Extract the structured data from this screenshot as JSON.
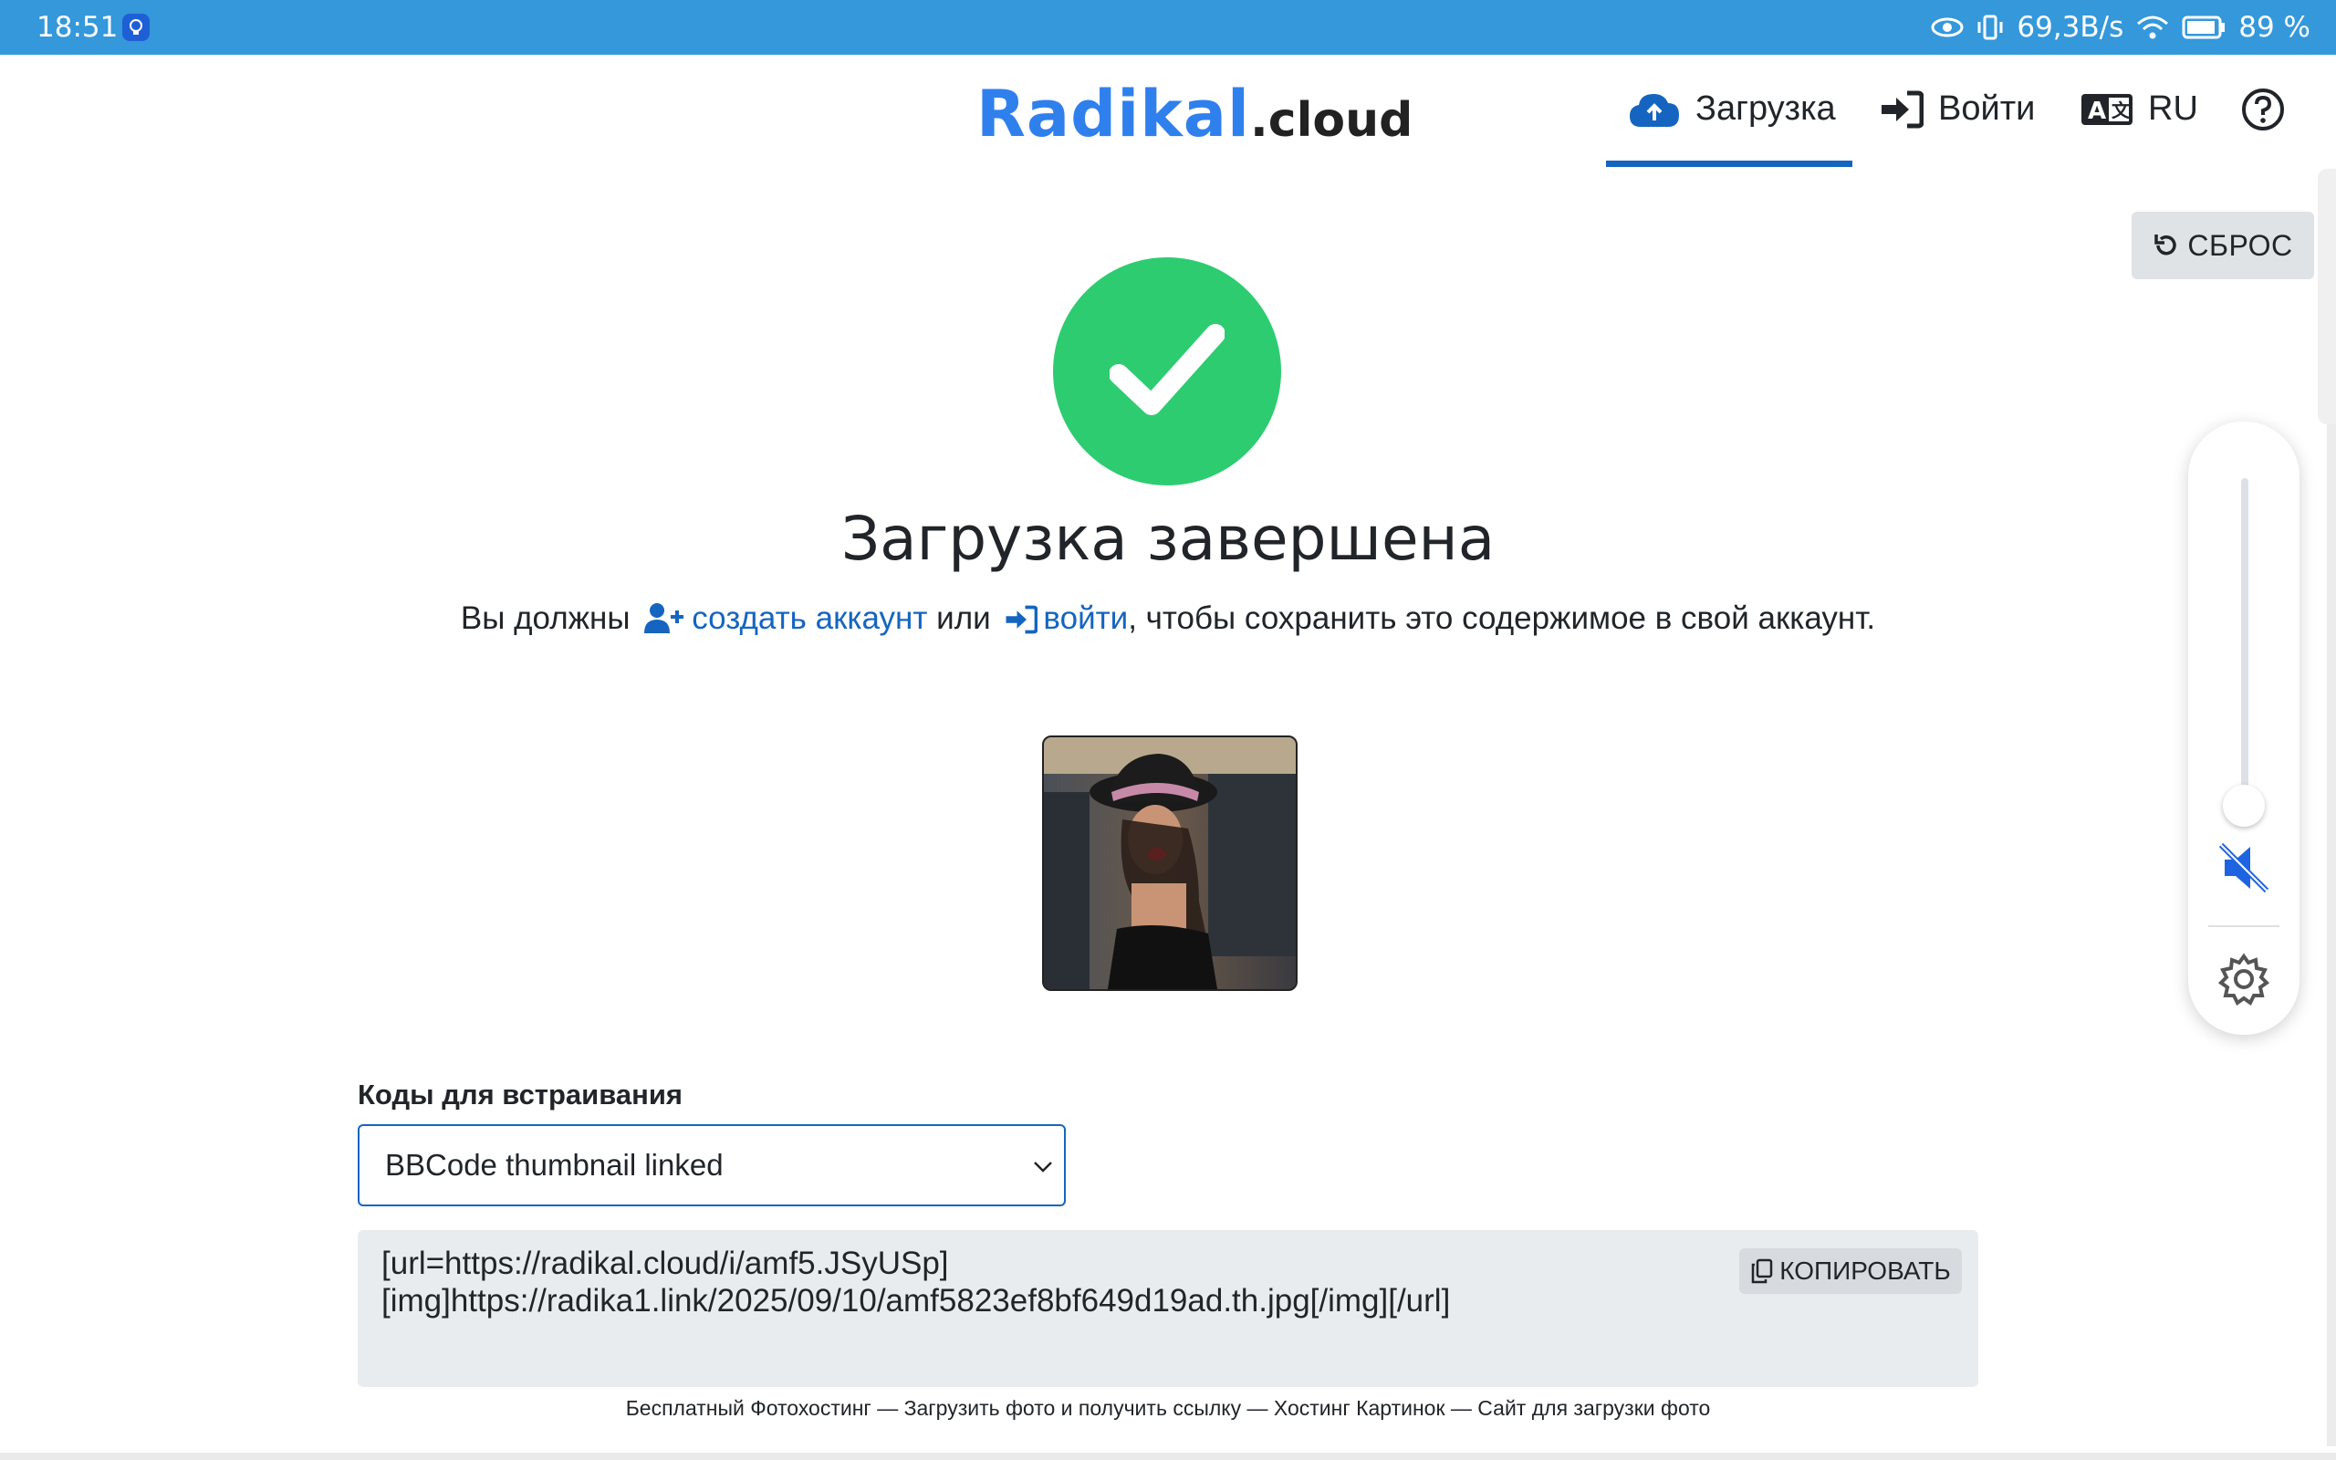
{
  "status_bar": {
    "time": "18:51",
    "network_speed": "69,3B/s",
    "battery": "89 %"
  },
  "header": {
    "logo_main": "Radikal",
    "logo_tld": ".cloud",
    "nav": {
      "upload": "Загрузка",
      "login": "Войти",
      "language": "RU"
    }
  },
  "reset_label": "СБРОС",
  "main": {
    "title": "Загрузка завершена",
    "message_prefix": "Вы должны",
    "create_account": "создать аккаунт",
    "or": "или",
    "login": "войти",
    "message_suffix": ", чтобы сохранить это содержимое в свой аккаунт."
  },
  "embed": {
    "label": "Коды для встраивания",
    "selected": "BBCode thumbnail linked",
    "code_line1": "[url=https://radikal.cloud/i/amf5.JSyUSp]",
    "code_line2": "[img]https://radika1.link/2025/09/10/amf5823ef8bf649d19ad.th.jpg[/img][/url]",
    "copy_label": "КОПИРОВАТЬ"
  },
  "footer": "Бесплатный Фотохостинг — Загрузить фото и получить ссылку — Хостинг Картинок — Сайт для загрузки фото",
  "colors": {
    "status_bar": "#3498db",
    "accent": "#1565c0",
    "success": "#2ecc71"
  }
}
